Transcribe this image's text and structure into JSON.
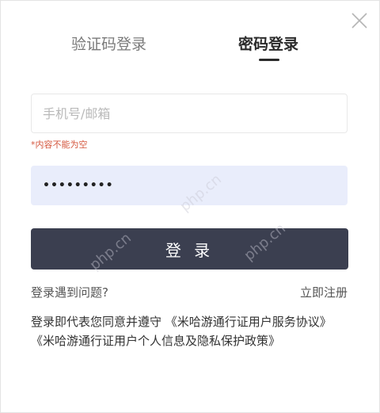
{
  "tabs": {
    "sms_login": "验证码登录",
    "password_login": "密码登录"
  },
  "account": {
    "placeholder": "手机号/邮箱",
    "value": "",
    "error": "*内容不能为空"
  },
  "password": {
    "value": "•••••••••"
  },
  "login_button": "登 录",
  "links": {
    "trouble": "登录遇到问题?",
    "register": "立即注册"
  },
  "agreement": {
    "prefix": "登录即代表您同意并遵守",
    "user_agreement": "《米哈游通行证用户服务协议》",
    "privacy_policy": "《米哈游通行证用户个人信息及隐私保护政策》"
  },
  "watermark": "php.cn",
  "colors": {
    "button_bg": "#3b3f50",
    "password_bg": "#e9edfb",
    "error": "#d4563d"
  }
}
